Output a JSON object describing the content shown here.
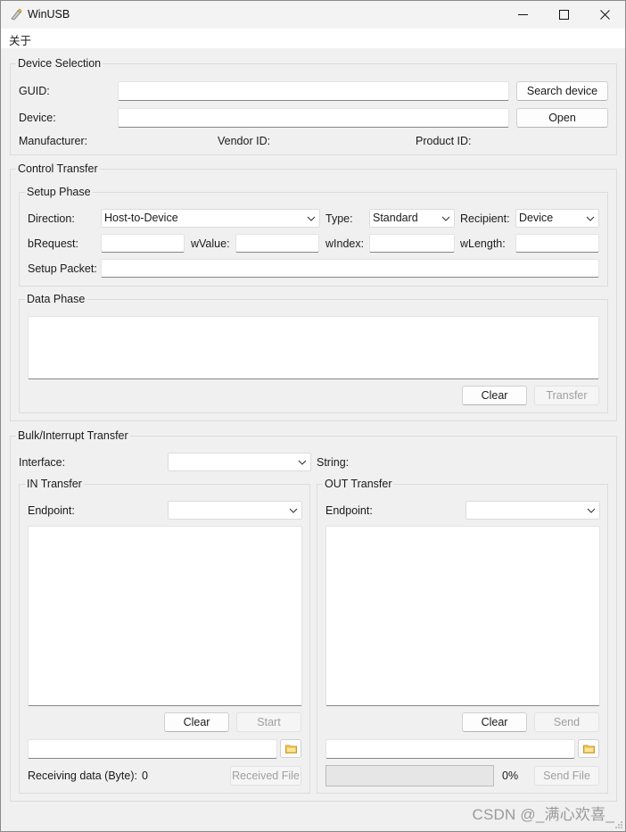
{
  "window": {
    "title": "WinUSB"
  },
  "menu": {
    "about": "关于"
  },
  "device_selection": {
    "title": "Device Selection",
    "guid_label": "GUID:",
    "guid_value": "",
    "device_label": "Device:",
    "device_value": "",
    "search_button": "Search device",
    "open_button": "Open",
    "manufacturer_label": "Manufacturer:",
    "vendor_id_label": "Vendor ID:",
    "product_id_label": "Product ID:"
  },
  "control_transfer": {
    "title": "Control Transfer",
    "setup_phase": {
      "title": "Setup Phase",
      "direction_label": "Direction:",
      "direction_value": "Host-to-Device",
      "type_label": "Type:",
      "type_value": "Standard",
      "recipient_label": "Recipient:",
      "recipient_value": "Device",
      "brequest_label": "bRequest:",
      "wvalue_label": "wValue:",
      "windex_label": "wIndex:",
      "wlength_label": "wLength:",
      "setup_packet_label": "Setup Packet:"
    },
    "data_phase": {
      "title": "Data Phase",
      "clear_button": "Clear",
      "transfer_button": "Transfer"
    }
  },
  "bulk_transfer": {
    "title": "Bulk/Interrupt Transfer",
    "interface_label": "Interface:",
    "interface_value": "",
    "string_label": "String:",
    "in_transfer": {
      "title": "IN Transfer",
      "endpoint_label": "Endpoint:",
      "clear_button": "Clear",
      "start_button": "Start",
      "receiving_label": "Receiving data (Byte):",
      "receiving_value": "0",
      "received_file_button": "Received File"
    },
    "out_transfer": {
      "title": "OUT Transfer",
      "endpoint_label": "Endpoint:",
      "clear_button": "Clear",
      "send_button": "Send",
      "progress_value": 0,
      "progress_text": "0%",
      "send_file_button": "Send File"
    }
  },
  "watermark": "CSDN @_满心欢喜_",
  "colors": {
    "background": "#f0f0f0",
    "input_bg": "#ffffff",
    "disabled_text": "#a0a0a0"
  },
  "icons": [
    "app-icon",
    "minimize-icon",
    "maximize-icon",
    "close-icon",
    "chevron-down-icon",
    "folder-icon"
  ]
}
